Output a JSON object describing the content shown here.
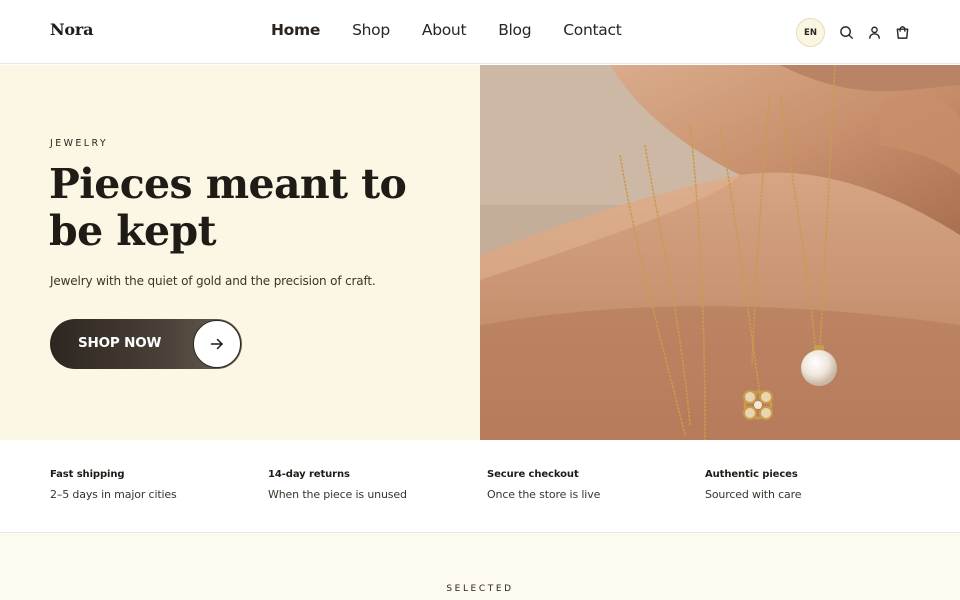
{
  "header": {
    "brand": "Nora",
    "nav": [
      {
        "label": "Home",
        "active": true
      },
      {
        "label": "Shop",
        "active": false
      },
      {
        "label": "About",
        "active": false
      },
      {
        "label": "Blog",
        "active": false
      },
      {
        "label": "Contact",
        "active": false
      }
    ],
    "language": "EN",
    "icons": [
      "search-icon",
      "account-icon",
      "cart-icon"
    ]
  },
  "hero": {
    "eyebrow": "JEWELRY",
    "headline": "Pieces meant to be kept",
    "subtext": "Jewelry with the quiet of gold and the precision of craft.",
    "cta_label": "SHOP NOW",
    "cta_icon": "arrow-right-icon",
    "image": "hand-wearing-gold-chain-necklaces-with-pearl-pendant"
  },
  "features": [
    {
      "title": "Fast shipping",
      "desc": "2–5 days in major cities"
    },
    {
      "title": "14-day returns",
      "desc": "When the piece is unused"
    },
    {
      "title": "Secure checkout",
      "desc": "Once the store is live"
    },
    {
      "title": "Authentic pieces",
      "desc": "Sourced with care"
    }
  ],
  "selected": {
    "title": "SELECTED"
  },
  "colors": {
    "hero_background": "#fcf7e5",
    "cta_background": "#2d2620",
    "text": "#1f1b16",
    "selected_background": "#fdfaf0"
  }
}
